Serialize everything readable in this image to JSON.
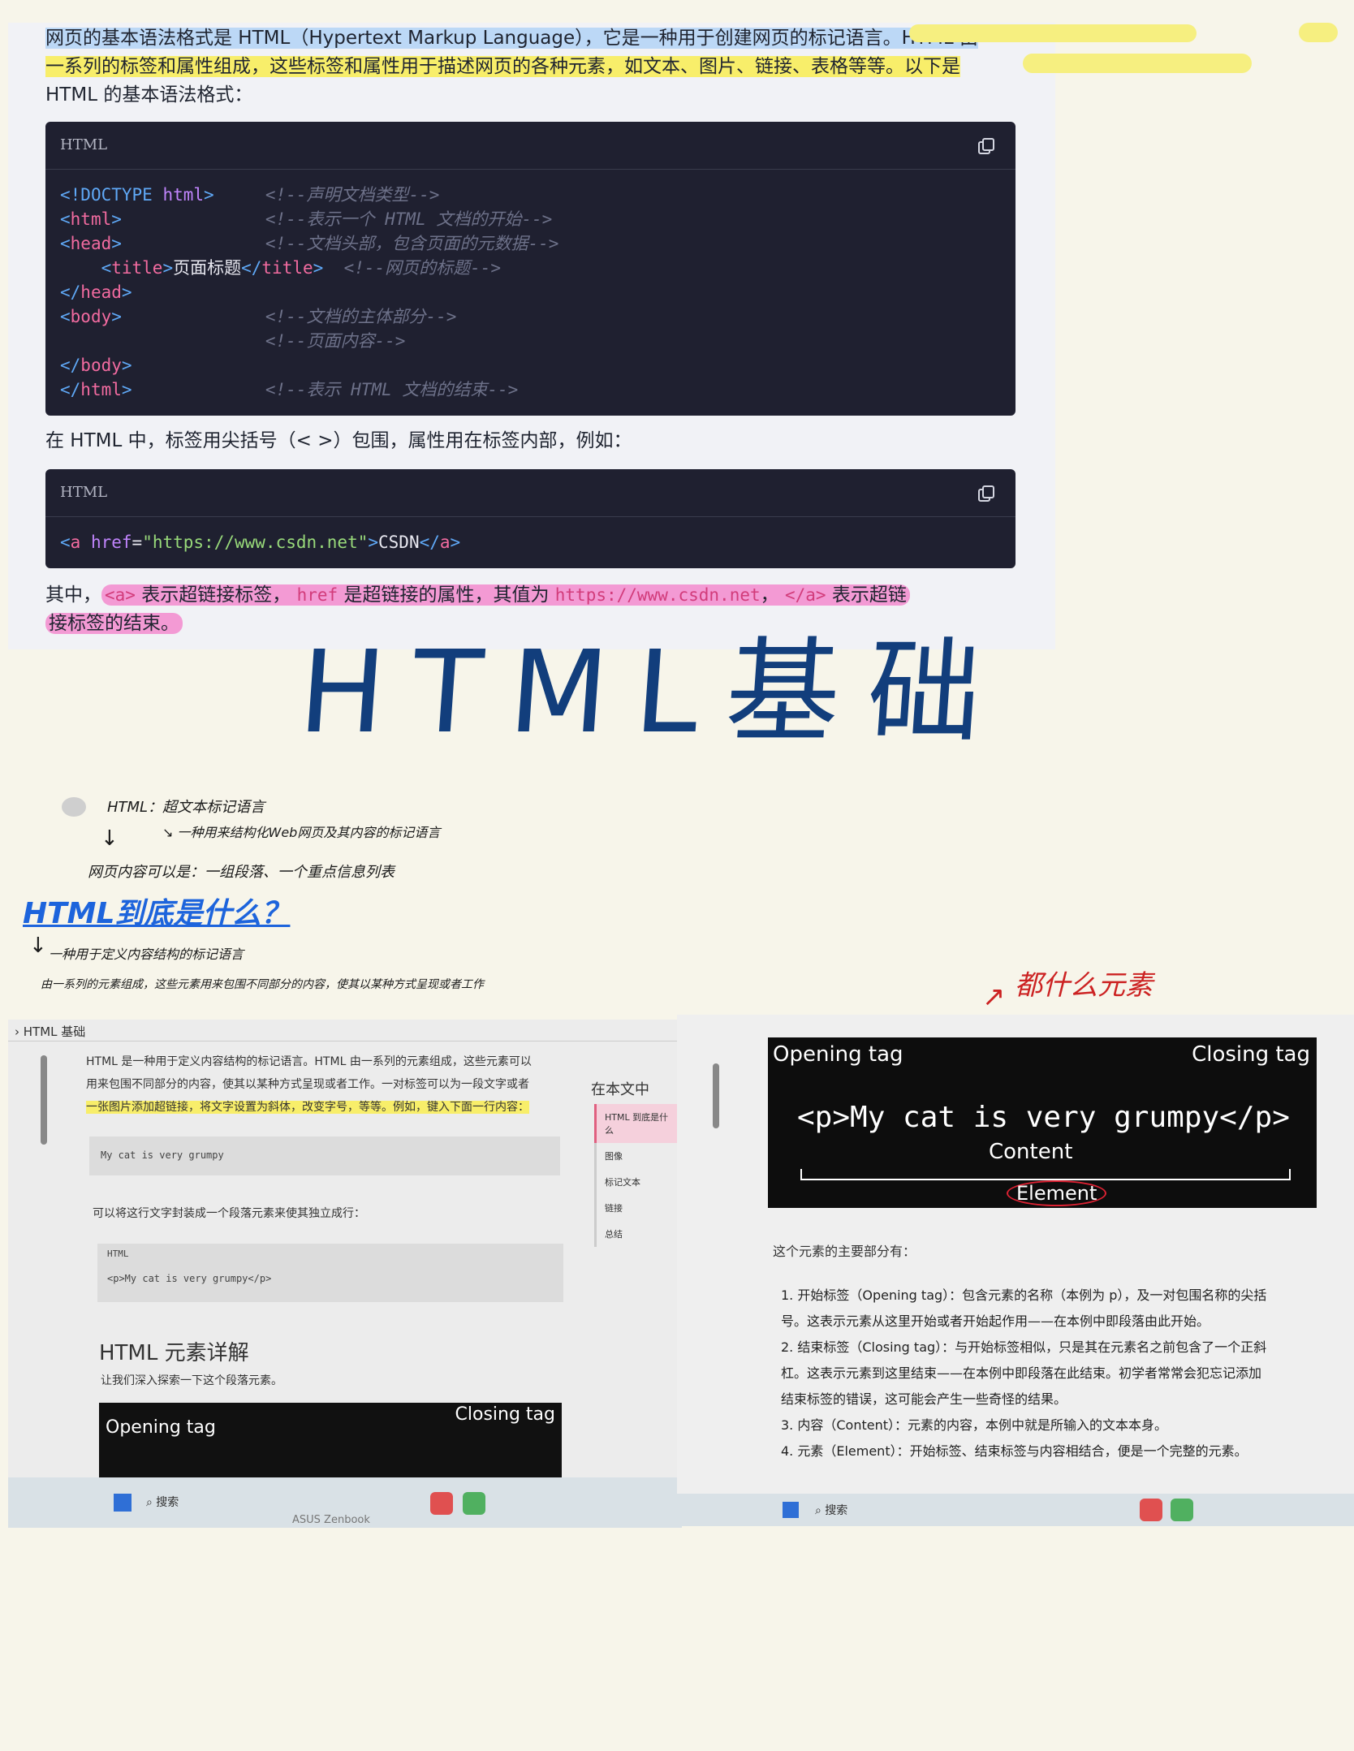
{
  "intro": {
    "line1": "网页的基本语法格式是 HTML（Hypertext Markup Language），它是一种用于创建网页的标记语言。HTML 由",
    "line2": "一系列的标签和属性组成，这些标签和属性用于描述网页的各种元素，如文本、图片、链接、表格等等。以下是",
    "line3": "HTML 的基本语法格式："
  },
  "code1": {
    "lang": "HTML",
    "lines": [
      {
        "code": "<!DOCTYPE html>",
        "comment": "<!--声明文档类型-->"
      },
      {
        "code": "<html>",
        "comment": "<!--表示一个 HTML 文档的开始-->"
      },
      {
        "code": "<head>",
        "comment": "<!--文档头部，包含页面的元数据-->"
      },
      {
        "code": "    <title>页面标题</title>",
        "comment": "<!--网页的标题-->"
      },
      {
        "code": "</head>",
        "comment": ""
      },
      {
        "code": "<body>",
        "comment": "<!--文档的主体部分-->"
      },
      {
        "code": "    ",
        "comment": "<!--页面内容-->"
      },
      {
        "code": "</body>",
        "comment": ""
      },
      {
        "code": "</html>",
        "comment": "<!--表示 HTML 文档的结束-->"
      }
    ]
  },
  "mid_text": "在 HTML 中，标签用尖括号（< >）包围，属性用在标签内部，例如：",
  "code2": {
    "lang": "HTML",
    "line": "<a href=\"https://www.csdn.net\">CSDN</a>"
  },
  "explain": {
    "pre": "其中，",
    "a_tag": "<a>",
    "t1": " 表示超链接标签， ",
    "href": "href",
    "t2": " 是超链接的属性，其值为 ",
    "url": "https://www.csdn.net",
    "t3": "， ",
    "close": "</a>",
    "t4": " 表示超链",
    "line2": "接标签的结束。"
  },
  "title": "HTML基础",
  "notes": {
    "html_label": "HTML：超文本标记语言",
    "html_def": "一种用来结构化Web网页及其内容的标记语言",
    "content_note": "网页内容可以是：一组段落、一个重点信息列表",
    "question": "HTML到底是什么？",
    "answer1": "一种用于定义内容结构的标记语言",
    "answer2": "由一系列的元素组成，这些元素用来包围不同部分的内容，使其以某种方式呈现或者工作",
    "red_note": "都什么元素"
  },
  "left_shot": {
    "breadcrumb": "HTML 基础",
    "p1": "HTML 是一种用于定义内容结构的标记语言。HTML 由一系列的元素组成，这些元素可以",
    "p2": "用来包围不同部分的内容，使其以某种方式呈现或者工作。一对标签可以为一段文字或者",
    "p3": "一张图片添加超链接，将文字设置为斜体，改变字号，等等。例如，键入下面一行内容：",
    "code_a": "My cat is very grumpy",
    "p4": "可以将这行文字封装成一个段落元素来使其独立成行：",
    "code_lang": "HTML",
    "code_b": "<p>My cat is very grumpy</p>",
    "heading": "HTML 元素详解",
    "p5": "让我们深入探索一下这个段落元素。",
    "opening": "Opening tag",
    "closing": "Closing tag",
    "toc_title": "在本文中",
    "toc": [
      "HTML 到底是什么",
      "图像",
      "标记文本",
      "链接",
      "总结"
    ],
    "search": "搜索",
    "brand": "ASUS Zenbook"
  },
  "right_shot": {
    "opening": "Opening tag",
    "closing": "Closing tag",
    "code": "<p>My cat is very grumpy</p>",
    "content": "Content",
    "element": "Element",
    "lead": "这个元素的主要部分有：",
    "items": [
      "1. 开始标签（Opening tag）：包含元素的名称（本例为 p），及一对包围名称的尖括",
      "号。这表示元素从这里开始或者开始起作用——在本例中即段落由此开始。",
      "2. 结束标签（Closing tag）：与开始标签相似，只是其在元素名之前包含了一个正斜",
      "杠。这表示元素到这里结束——在本例中即段落在此结束。初学者常常会犯忘记添加",
      "结束标签的错误，这可能会产生一些奇怪的结果。",
      "3. 内容（Content）：元素的内容，本例中就是所输入的文本本身。",
      "4. 元素（Element）：开始标签、结束标签与内容相结合，便是一个完整的元素。"
    ],
    "search": "搜索"
  }
}
